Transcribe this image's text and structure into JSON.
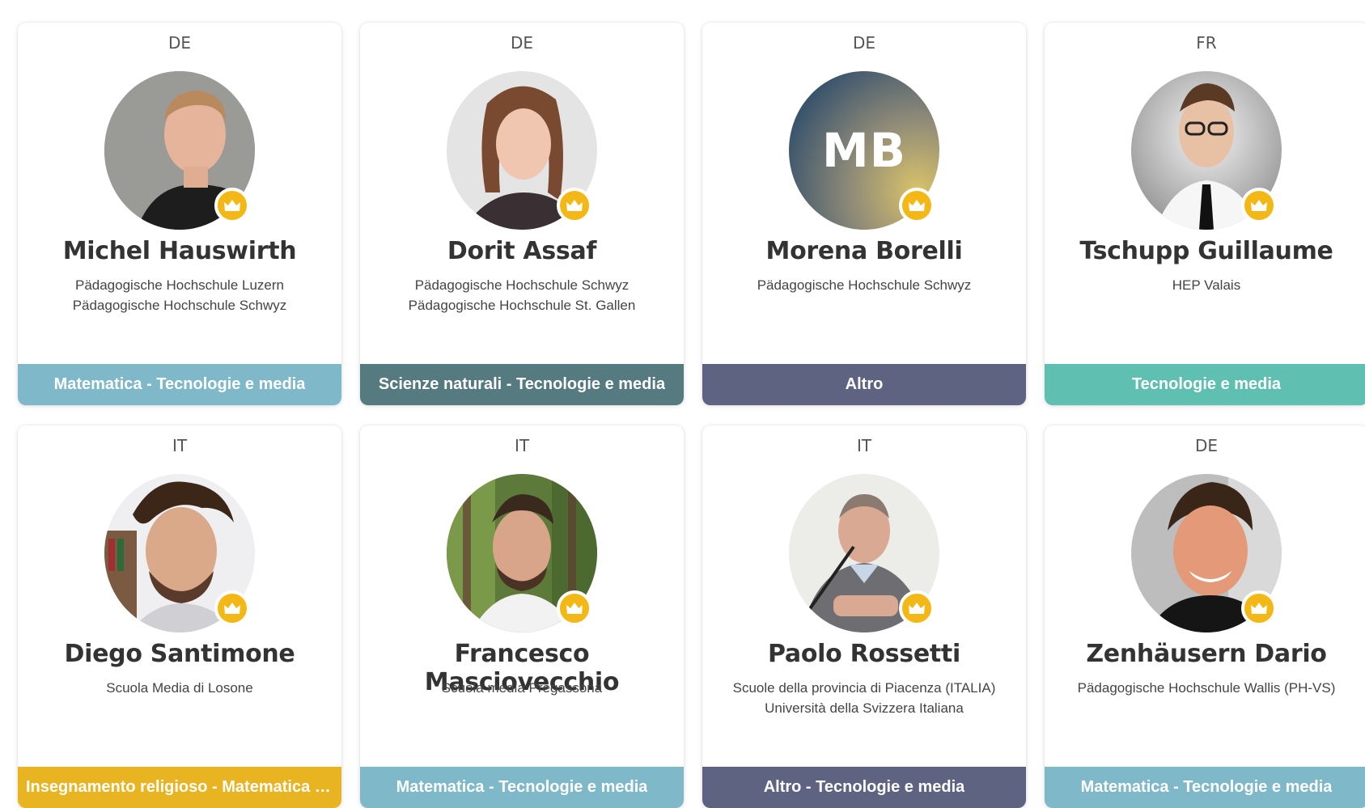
{
  "cards": [
    {
      "lang": "DE",
      "name": "Michel Hauswirth",
      "institutions": [
        "Pädagogische Hochschule Luzern",
        "Pädagogische Hochschule Schwyz"
      ],
      "subject": "Matematica - Tecnologie e media",
      "subject_color": "#7fb8c8"
    },
    {
      "lang": "DE",
      "name": "Dorit Assaf",
      "institutions": [
        "Pädagogische Hochschule Schwyz",
        "Pädagogische Hochschule St. Gallen"
      ],
      "subject": "Scienze naturali - Tecnologie e media",
      "subject_color": "#557a80"
    },
    {
      "lang": "DE",
      "name": "Morena Borelli",
      "initials": "MB",
      "institutions": [
        "Pädagogische Hochschule Schwyz"
      ],
      "subject": "Altro",
      "subject_color": "#5e6381"
    },
    {
      "lang": "FR",
      "name": "Tschupp Guillaume",
      "institutions": [
        "HEP Valais"
      ],
      "subject": "Tecnologie e media",
      "subject_color": "#5fbfb0"
    },
    {
      "lang": "IT",
      "name": "Diego Santimone",
      "institutions": [
        "Scuola Media di Losone"
      ],
      "subject": "Insegnamento religioso - Matematica - Tecnologie e media",
      "subject_color": "#e9b422"
    },
    {
      "lang": "IT",
      "name": "Francesco Masciovecchio",
      "institutions": [
        "Scuola media Pregassona"
      ],
      "subject": "Matematica - Tecnologie e media",
      "subject_color": "#7fb8c8"
    },
    {
      "lang": "IT",
      "name": "Paolo Rossetti",
      "institutions": [
        "Scuole della provincia di Piacenza (ITALIA)",
        "Università della Svizzera Italiana"
      ],
      "subject": "Altro - Tecnologie e media",
      "subject_color": "#5e6381"
    },
    {
      "lang": "DE",
      "name": "Zenhäusern Dario",
      "institutions": [
        "Pädagogische Hochschule Wallis (PH-VS)"
      ],
      "subject": "Matematica - Tecnologie e media",
      "subject_color": "#7fb8c8"
    }
  ],
  "badge_icon": "crown-icon",
  "badge_color": "#f3b815"
}
